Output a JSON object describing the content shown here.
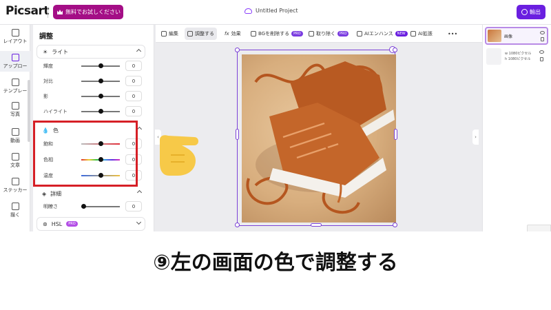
{
  "app": {
    "logo": "Picsart",
    "trial_button": "無料でお試しください",
    "project_title": "Untitled Project",
    "export_button": "輸出"
  },
  "leftnav": {
    "items": [
      {
        "label": "レイアウト",
        "icon": "layout-icon"
      },
      {
        "label": "アップロー",
        "icon": "upload-icon"
      },
      {
        "label": "テンプレー",
        "icon": "template-icon"
      },
      {
        "label": "写真",
        "icon": "photo-icon"
      },
      {
        "label": "動画",
        "icon": "video-icon"
      },
      {
        "label": "文章",
        "icon": "text-icon"
      },
      {
        "label": "ステッカー",
        "icon": "sticker-icon"
      },
      {
        "label": "描く",
        "icon": "draw-icon"
      }
    ]
  },
  "toolbar": {
    "items": [
      {
        "label": "編集",
        "icon": "edit-icon"
      },
      {
        "label": "調整する",
        "icon": "adjust-icon"
      },
      {
        "label": "効果",
        "icon": "effects-icon"
      },
      {
        "label": "BGを削除する",
        "badge": "PRO",
        "icon": "remove-bg-icon"
      },
      {
        "label": "取り除く",
        "badge": "PRO",
        "icon": "eraser-icon"
      },
      {
        "label": "AIエンハンス",
        "badge": "NEW",
        "icon": "ai-enhance-icon"
      },
      {
        "label": "AI拡張",
        "icon": "ai-expand-icon"
      },
      {
        "label": "•••",
        "icon": "more-icon"
      }
    ]
  },
  "panel": {
    "title": "調整",
    "light": {
      "title": "ライト",
      "rows": [
        {
          "label": "輝度",
          "value": "0",
          "level": 0.5
        },
        {
          "label": "対比",
          "value": "0",
          "level": 0.5
        },
        {
          "label": "影",
          "value": "0",
          "level": 0.5
        },
        {
          "label": "ハイライト",
          "value": "0",
          "level": 0.5
        }
      ]
    },
    "color": {
      "title": "色",
      "rows": [
        {
          "label": "飽和",
          "value": "0",
          "level": 0.5
        },
        {
          "label": "色相",
          "value": "0",
          "level": 0.5
        },
        {
          "label": "温度",
          "value": "0",
          "level": 0.5
        }
      ]
    },
    "detail": {
      "title": "詳細",
      "rows": [
        {
          "label": "明瞭さ",
          "value": "0",
          "level": 0.0
        }
      ]
    },
    "hsl": {
      "title": "HSL",
      "badge": "PRO"
    }
  },
  "layers": {
    "layer1_name": "画像",
    "layer2_width": "w 1080ピクセル",
    "layer2_height": "h 1080ピクセル"
  },
  "caption": "⑨左の画面の色で調整する",
  "colors": {
    "accent": "#6a1fe0",
    "trial": "#a40e86",
    "highlight": "#d61f26",
    "hand": "#f7c948"
  }
}
